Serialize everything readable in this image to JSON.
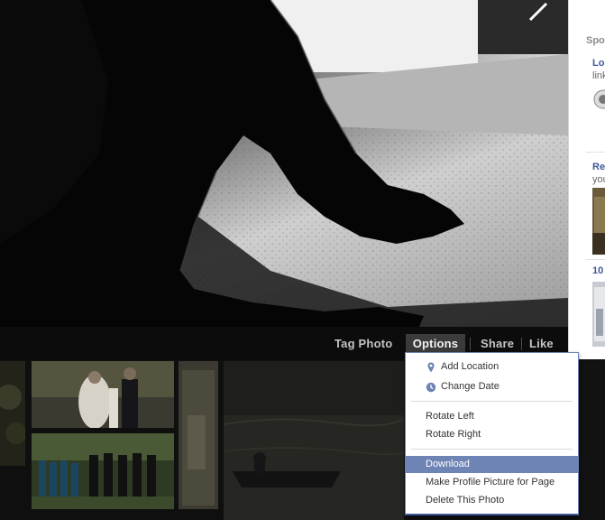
{
  "actions": {
    "tag_photo": "Tag Photo",
    "options": "Options",
    "share": "Share",
    "like": "Like"
  },
  "options_menu": {
    "items": [
      {
        "label": "Add Location",
        "icon": "map-pin-icon"
      },
      {
        "label": "Change Date",
        "icon": "clock-icon"
      },
      {
        "label": "Rotate Left"
      },
      {
        "label": "Rotate Right"
      },
      {
        "label": "Download",
        "highlighted": true
      },
      {
        "label": "Make Profile Picture for Page"
      },
      {
        "label": "Delete This Photo"
      }
    ]
  },
  "sidebar": {
    "header": "Spo",
    "ads": [
      {
        "title": "Loc",
        "text": "link"
      },
      {
        "title": "Re",
        "text": "you"
      },
      {
        "title": "10"
      }
    ]
  },
  "colors": {
    "menu_highlight": "#6d84b4",
    "link_blue": "#3b5998",
    "options_button_bg": "#3b3b3b"
  }
}
